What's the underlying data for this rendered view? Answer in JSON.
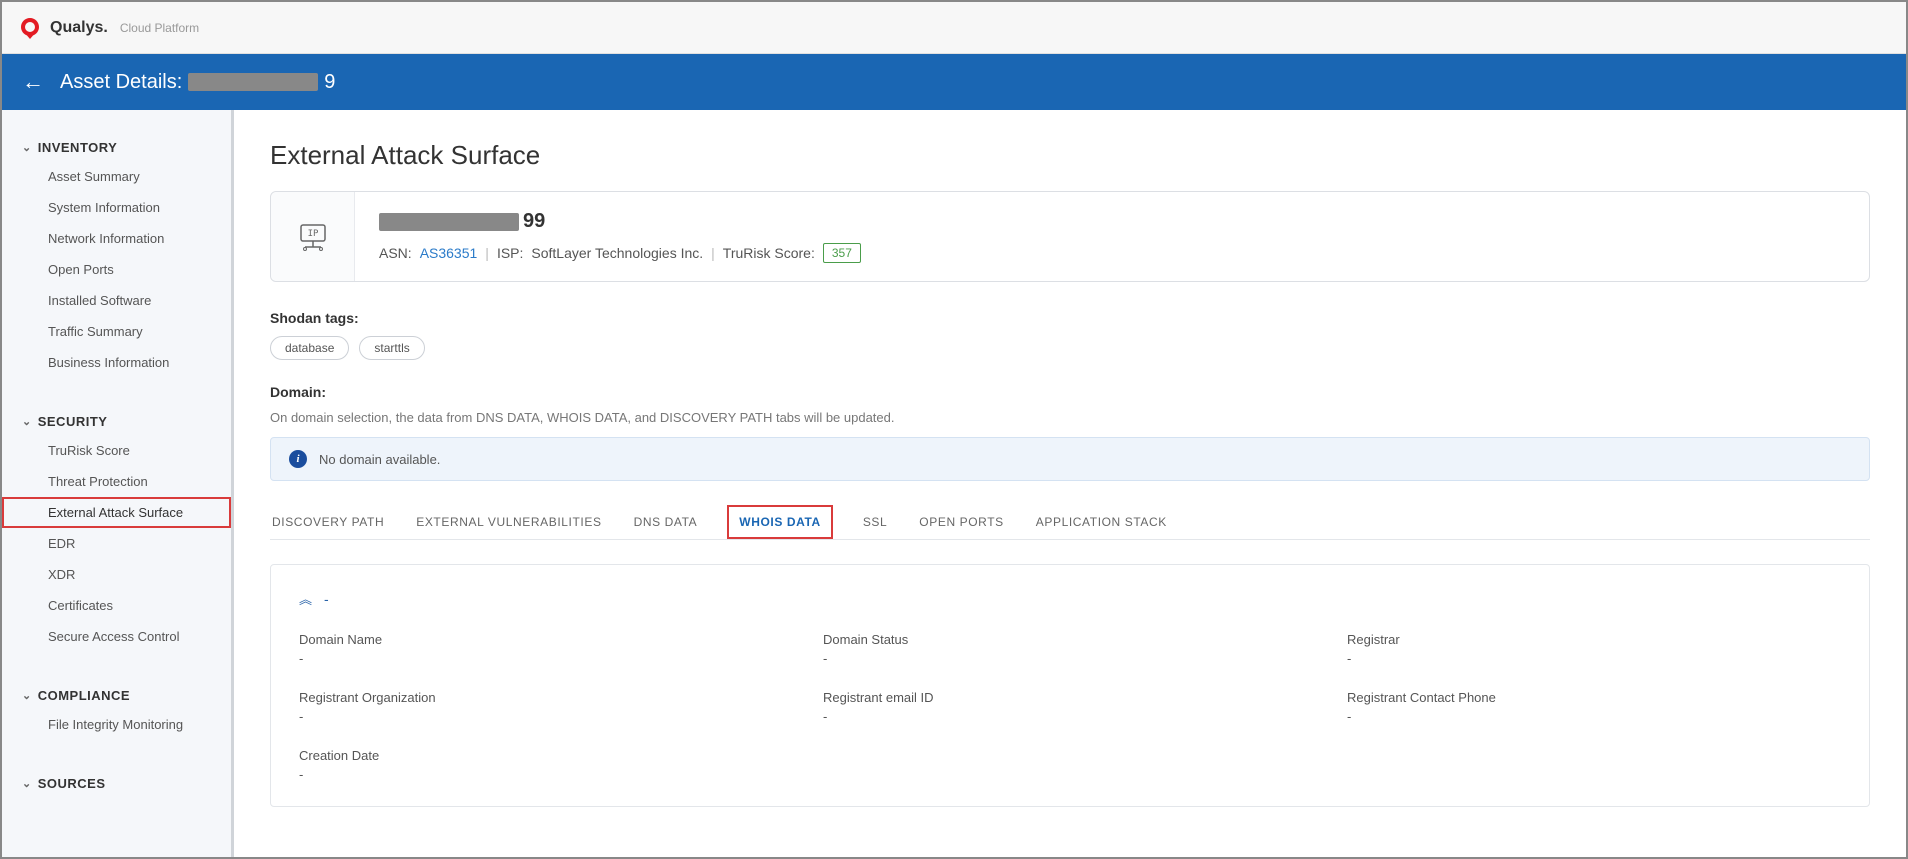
{
  "brand": {
    "name": "Qualys.",
    "sub": "Cloud Platform"
  },
  "header": {
    "title_prefix": "Asset Details:",
    "title_suffix": "9"
  },
  "sidebar": {
    "sections": [
      {
        "label": "INVENTORY",
        "items": [
          "Asset Summary",
          "System Information",
          "Network Information",
          "Open Ports",
          "Installed Software",
          "Traffic Summary",
          "Business Information"
        ]
      },
      {
        "label": "SECURITY",
        "items": [
          "TruRisk Score",
          "Threat Protection",
          "External Attack Surface",
          "EDR",
          "XDR",
          "Certificates",
          "Secure Access Control"
        ],
        "active": "External Attack Surface"
      },
      {
        "label": "COMPLIANCE",
        "items": [
          "File Integrity Monitoring"
        ]
      },
      {
        "label": "SOURCES",
        "items": []
      }
    ]
  },
  "main": {
    "page_title": "External Attack Surface",
    "summary": {
      "ip_suffix": "99",
      "asn_label": "ASN:",
      "asn_value": "AS36351",
      "isp_label": "ISP:",
      "isp_value": "SoftLayer Technologies Inc.",
      "score_label": "TruRisk Score:",
      "score_value": "357"
    },
    "shodan": {
      "label": "Shodan tags:",
      "tags": [
        "database",
        "starttls"
      ]
    },
    "domain": {
      "label": "Domain:",
      "desc": "On domain selection, the data from DNS DATA, WHOIS DATA, and DISCOVERY PATH tabs will be updated.",
      "banner": "No domain available."
    },
    "tabs": [
      "DISCOVERY PATH",
      "EXTERNAL VULNERABILITIES",
      "DNS DATA",
      "WHOIS DATA",
      "SSL",
      "OPEN PORTS",
      "APPLICATION STACK"
    ],
    "active_tab": "WHOIS DATA",
    "whois": {
      "collapse_title": "-",
      "fields": [
        {
          "label": "Domain Name",
          "value": "-"
        },
        {
          "label": "Domain Status",
          "value": "-"
        },
        {
          "label": "Registrar",
          "value": "-"
        },
        {
          "label": "Registrant Organization",
          "value": "-"
        },
        {
          "label": "Registrant email ID",
          "value": "-"
        },
        {
          "label": "Registrant Contact Phone",
          "value": "-"
        },
        {
          "label": "Creation Date",
          "value": "-"
        }
      ]
    }
  }
}
